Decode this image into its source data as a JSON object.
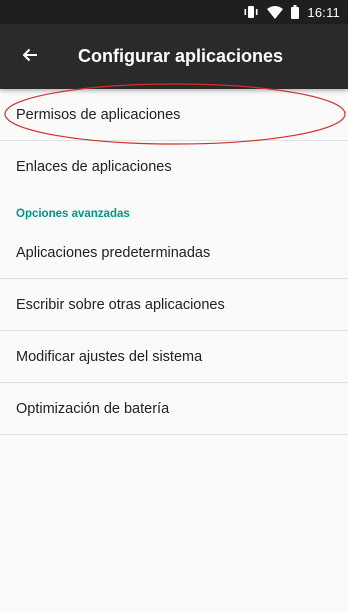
{
  "status_bar": {
    "time": "16:11",
    "icons": [
      "vibrate-icon",
      "wifi-icon",
      "battery-icon"
    ]
  },
  "app_bar": {
    "back_icon": "arrow-back-icon",
    "title": "Configurar aplicaciones"
  },
  "list": {
    "items_top": [
      "Permisos de aplicaciones",
      "Enlaces de aplicaciones"
    ],
    "section_header": "Opciones avanzadas",
    "items_advanced": [
      "Aplicaciones predeterminadas",
      "Escribir sobre otras aplicaciones",
      "Modificar ajustes del sistema",
      "Optimización de batería"
    ]
  },
  "colors": {
    "status_bar": "#1f1f1f",
    "app_bar": "#2a2a2a",
    "accent": "#009688",
    "annotation": "#d32f2f",
    "background": "#fafafa"
  }
}
